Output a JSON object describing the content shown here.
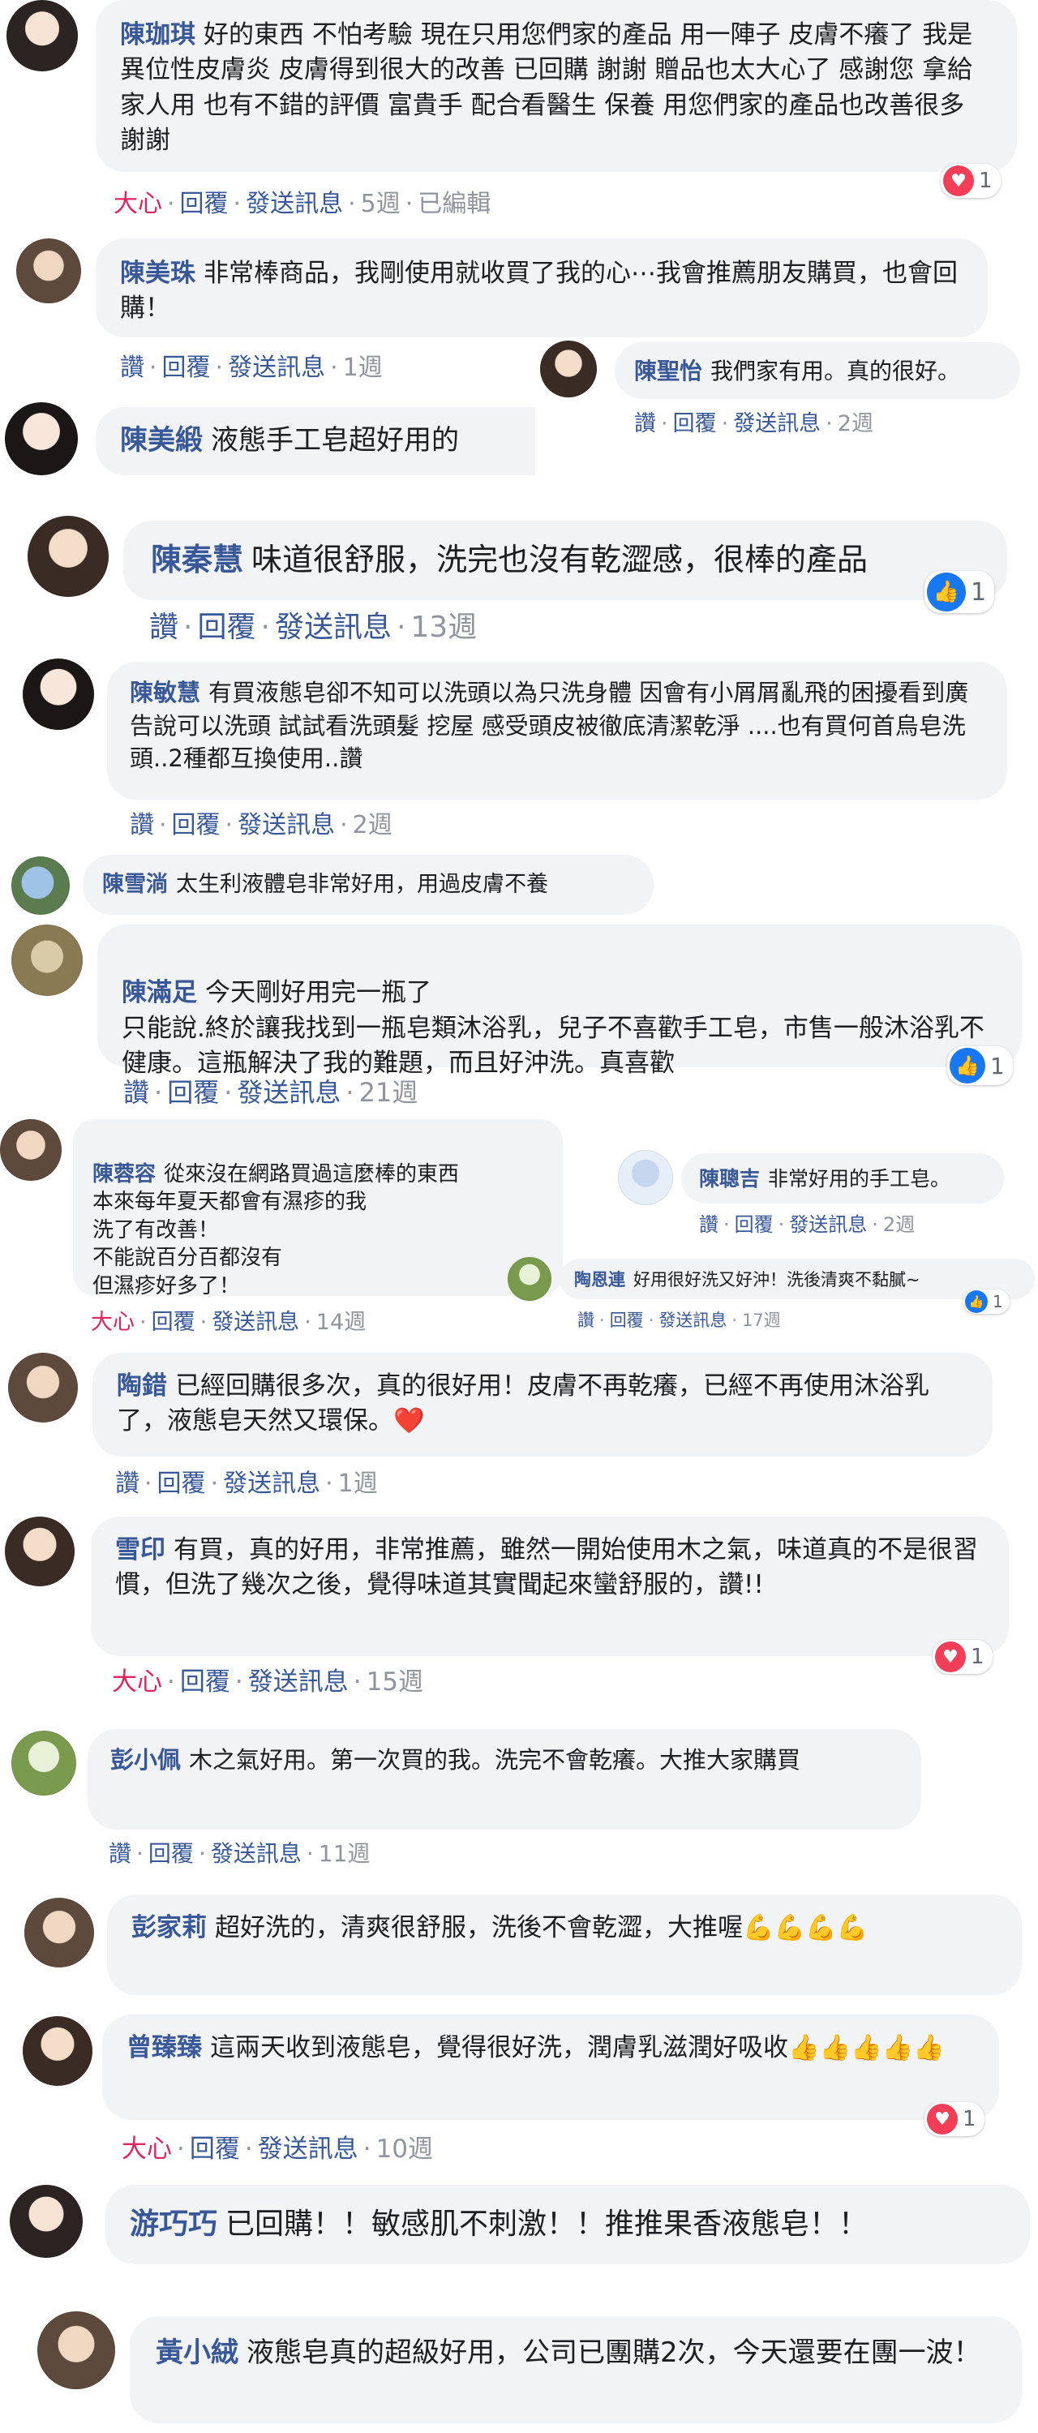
{
  "comments": [
    {
      "id": "c1",
      "name": "陳珈琪",
      "text": "好的東西 不怕考驗 現在只用您們家的產品 用一陣子 皮膚不癢了 我是異位性皮膚炎 皮膚得到很大的改善 已回購 謝謝 贈品也太大心了 感謝您 拿給家人用 也有不錯的評價 富貴手 配合看醫生 保養 用您們家的產品也改善很多 謝謝",
      "actions": [
        "大心",
        "回覆",
        "發送訊息",
        "5週",
        "已編輯"
      ],
      "reaction": {
        "type": "heart",
        "count": "1"
      }
    },
    {
      "id": "c2",
      "name": "陳美珠",
      "text": "非常棒商品，我剛使用就收買了我的心⋯我會推薦朋友購買，也會回購！",
      "actions": [
        "讚",
        "回覆",
        "發送訊息",
        "1週"
      ]
    },
    {
      "id": "c3",
      "name": "陳聖怡",
      "text": "我們家有用。真的很好。",
      "actions": [
        "讚",
        "回覆",
        "發送訊息",
        "2週"
      ]
    },
    {
      "id": "c4",
      "name": "陳美緞",
      "text": "液態手工皂超好用的"
    },
    {
      "id": "c5",
      "name": "陳秦慧",
      "text": "味道很舒服，洗完也沒有乾澀感，很棒的產品",
      "actions": [
        "讚",
        "回覆",
        "發送訊息",
        "13週"
      ],
      "reaction": {
        "type": "like",
        "count": "1"
      }
    },
    {
      "id": "c6",
      "name": "陳敏慧",
      "text": "有買液態皂卻不知可以洗頭以為只洗身體 因會有小屑屑亂飛的困擾看到廣告說可以洗頭 試試看洗頭髮 挖屋 感受頭皮被徹底清潔乾淨 ....也有買何首烏皂洗頭..2種都互換使用..讚",
      "actions": [
        "讚",
        "回覆",
        "發送訊息",
        "2週"
      ]
    },
    {
      "id": "c7",
      "name": "陳雪淌",
      "text": "太生利液體皂非常好用，用過皮膚不養"
    },
    {
      "id": "c8",
      "name": "陳滿足",
      "text": "今天剛好用完一瓶了\n只能說.終於讓我找到一瓶皂類沐浴乳，兒子不喜歡手工皂，市售一般沐浴乳不健康。這瓶解決了我的難題，而且好沖洗。真喜歡",
      "actions": [
        "讚",
        "回覆",
        "發送訊息",
        "21週"
      ],
      "reaction": {
        "type": "like",
        "count": "1"
      }
    },
    {
      "id": "c9",
      "name": "陳蓉容",
      "text": "從來沒在網路買過這麼棒的東西\n本來每年夏天都會有濕疹的我\n洗了有改善！\n不能說百分百都沒有\n但濕疹好多了！",
      "actions": [
        "大心",
        "回覆",
        "發送訊息",
        "14週"
      ]
    },
    {
      "id": "c10",
      "name": "陳聰吉",
      "text": "非常好用的手工皂。",
      "actions": [
        "讚",
        "回覆",
        "發送訊息",
        "2週"
      ]
    },
    {
      "id": "c11",
      "name": "陶恩連",
      "text": "好用很好洗又好沖！洗後清爽不黏膩~",
      "actions": [
        "讚",
        "回覆",
        "發送訊息",
        "17週"
      ],
      "reaction": {
        "type": "like",
        "count": "1"
      }
    },
    {
      "id": "c12",
      "name": "陶錯",
      "text": "已經回購很多次，真的很好用！皮膚不再乾癢，已經不再使用沐浴乳了，液態皂天然又環保。",
      "emoji": "❤️",
      "actions": [
        "讚",
        "回覆",
        "發送訊息",
        "1週"
      ]
    },
    {
      "id": "c13",
      "name": "雪印",
      "text": "有買，真的好用，非常推薦，雖然一開始使用木之氣，味道真的不是很習慣，但洗了幾次之後，覺得味道其實聞起來蠻舒服的，讚!!",
      "actions": [
        "大心",
        "回覆",
        "發送訊息",
        "15週"
      ],
      "reaction": {
        "type": "heart",
        "count": "1"
      }
    },
    {
      "id": "c14",
      "name": "彭小佩",
      "text": "木之氣好用。第一次買的我。洗完不會乾癢。大推大家購買",
      "actions": [
        "讚",
        "回覆",
        "發送訊息",
        "11週"
      ]
    },
    {
      "id": "c15",
      "name": "彭家莉",
      "text": "超好洗的，清爽很舒服，洗後不會乾澀，大推喔",
      "emoji": "💪💪💪💪"
    },
    {
      "id": "c16",
      "name": "曾臻臻",
      "text": "這兩天收到液態皂，覺得很好洗，潤膚乳滋潤好吸收",
      "emoji": "👍👍👍👍👍",
      "actions": [
        "大心",
        "回覆",
        "發送訊息",
        "10週"
      ],
      "reaction": {
        "type": "heart",
        "count": "1"
      }
    },
    {
      "id": "c17",
      "name": "游巧巧",
      "text": "已回購！！敏感肌不刺激！！推推果香液態皂！！"
    },
    {
      "id": "c18",
      "name": "黃小絨",
      "text": "液態皂真的超級好用，公司已團購2次，今天還要在團一波！"
    }
  ],
  "colors": {
    "bubble": "#f2f3f5",
    "name": "#385898",
    "love": "#e0245e",
    "muted": "#90949c",
    "like": "#1877f2",
    "heart": "#f33e58"
  }
}
